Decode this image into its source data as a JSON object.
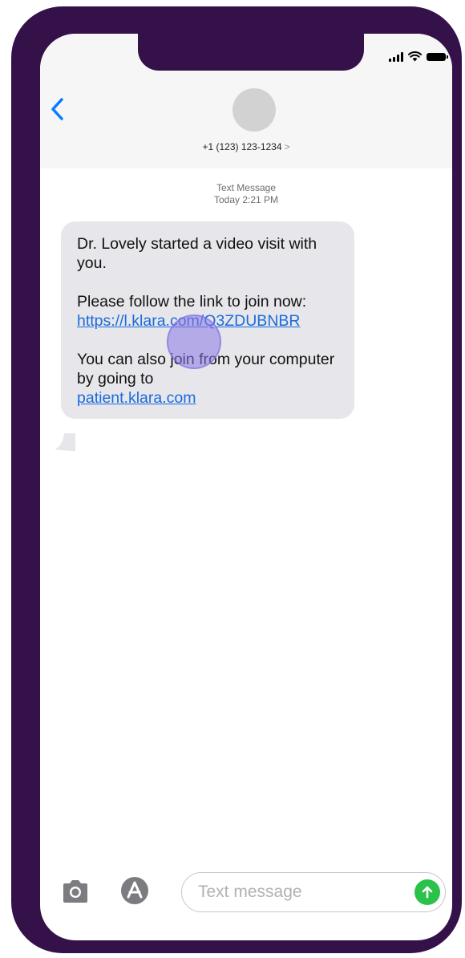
{
  "status_bar": {
    "icons": [
      "signal-icon",
      "wifi-icon",
      "battery-icon"
    ]
  },
  "header": {
    "back_icon": "chevron-left-icon",
    "contact_number": "+1 (123) 123-1234",
    "contact_chevron": ">"
  },
  "conversation": {
    "meta_label": "Text Message",
    "meta_time": "Today 2:21 PM",
    "message": {
      "line1": "Dr. Lovely started a video visit with you.",
      "line2": "Please follow the link to join now:",
      "link1": "https://l.klara.com/Q3ZDUBNBR",
      "line3": "You can also join from your computer by going to",
      "link2": "patient.klara.com"
    }
  },
  "compose": {
    "camera_icon": "camera-icon",
    "apps_icon": "app-store-icon",
    "placeholder": "Text message",
    "send_icon": "arrow-up-icon"
  },
  "colors": {
    "frame": "#341148",
    "link": "#1a6cdb",
    "bubble": "#e7e6ea",
    "send": "#2bc24a",
    "ios_blue": "#0a7aff"
  }
}
